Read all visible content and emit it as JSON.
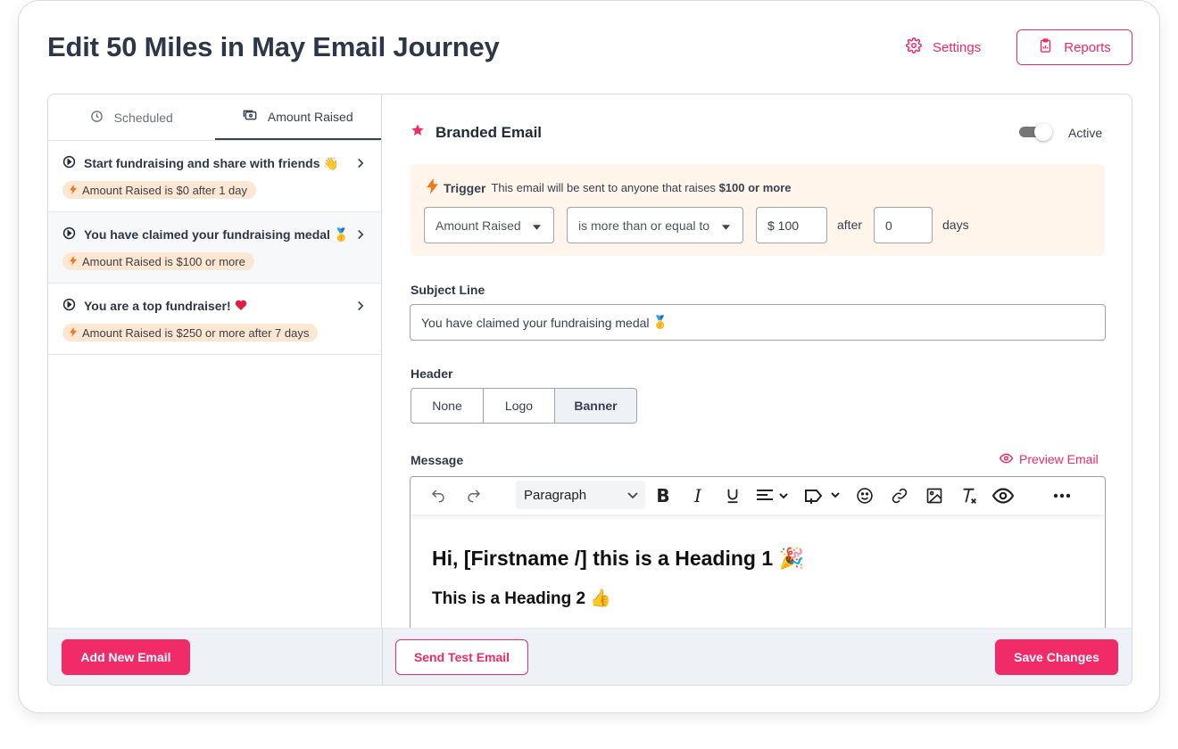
{
  "page": {
    "title": "Edit 50 Miles in May Email Journey"
  },
  "header": {
    "settings_label": "Settings",
    "reports_label": "Reports"
  },
  "tabs": [
    {
      "label": "Scheduled",
      "icon": "clock-icon"
    },
    {
      "label": "Amount Raised",
      "icon": "money-icon",
      "active": true
    }
  ],
  "emails": [
    {
      "title": "Start fundraising and share with friends",
      "emoji": "👋",
      "badge": "Amount Raised is $0 after 1 day"
    },
    {
      "title": "You have claimed your fundraising medal",
      "emoji": "🥇",
      "badge": "Amount Raised is $100 or more",
      "selected": true
    },
    {
      "title": "You are a top fundraiser!",
      "emoji": "❤️",
      "badge": "Amount Raised is $250 or more after 7 days"
    }
  ],
  "detail": {
    "heading": "Branded Email",
    "active_label": "Active",
    "active": true,
    "trigger": {
      "label": "Trigger",
      "description": "This email will be sent to anyone that raises",
      "amount_text": "$100 or more",
      "metric": "Amount Raised",
      "comparator": "is more than or equal to",
      "amount_value": "$ 100",
      "after_label": "after",
      "days_value": "0",
      "days_label": "days"
    },
    "subject": {
      "label": "Subject Line",
      "value": "You have claimed your fundraising medal",
      "emoji": "🥇"
    },
    "header_field": {
      "label": "Header",
      "options": [
        "None",
        "Logo",
        "Banner"
      ],
      "selected": "Banner"
    },
    "message": {
      "label": "Message",
      "preview_label": "Preview Email",
      "block_style": "Paragraph",
      "heading1": "Hi, [Firstname /] this is a Heading 1",
      "heading1_emoji": "🎉",
      "heading2": "This is a Heading 2",
      "heading2_emoji": "👍"
    }
  },
  "footer": {
    "add_new_label": "Add New Email",
    "send_test_label": "Send Test Email",
    "save_label": "Save Changes"
  },
  "colors": {
    "accent": "#f02b68",
    "badge_bg": "#fde7d3",
    "trigger_bg": "#fff5eb",
    "bolt": "#f97316"
  }
}
